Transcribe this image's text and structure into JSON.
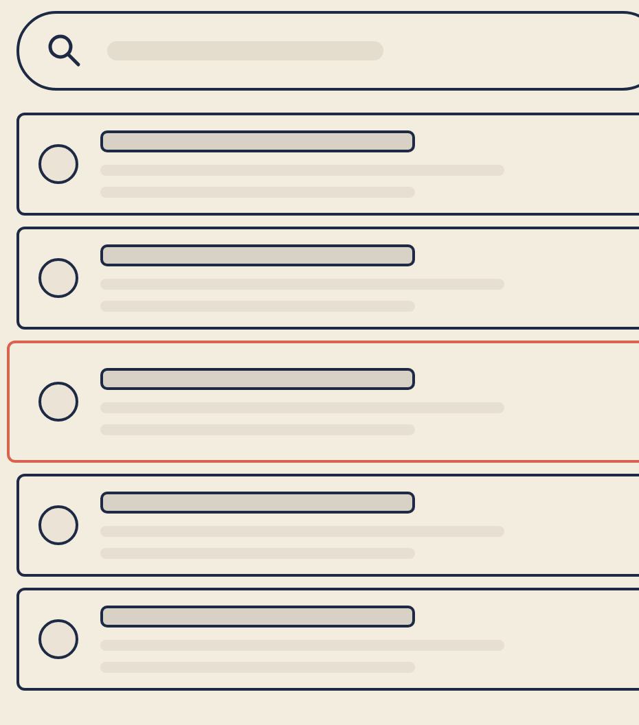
{
  "cards": [
    {
      "selected": false
    },
    {
      "selected": false
    },
    {
      "selected": true
    },
    {
      "selected": false
    },
    {
      "selected": false
    }
  ]
}
